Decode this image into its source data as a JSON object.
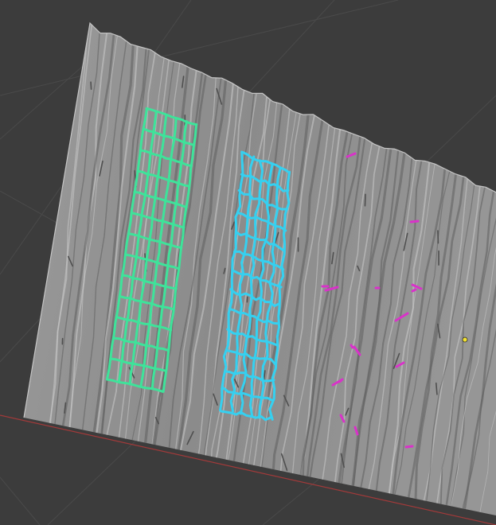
{
  "viewport": {
    "name": "3D Viewport",
    "background_color": "#3c3c3c",
    "grid_color": "#4a4a4a",
    "x_axis_color": "#a13a3a"
  },
  "plane": {
    "name": "sculpted-wood-plane",
    "surface_color": "#8e8e8e",
    "shadow_color": "#5e5e5e",
    "highlight_color": "#c6c6c6"
  },
  "face_sets": [
    {
      "name": "green-face-set",
      "color": "#3ee39a",
      "columns": 5,
      "rows": 13
    },
    {
      "name": "cyan-face-set",
      "color": "#35d0f0",
      "columns": 5,
      "rows": 13
    }
  ],
  "strokes": {
    "name": "magenta-hair-strokes",
    "color": "#d932c9",
    "count": 16
  },
  "origin_point": {
    "name": "object-origin",
    "color": "#f3e231"
  }
}
